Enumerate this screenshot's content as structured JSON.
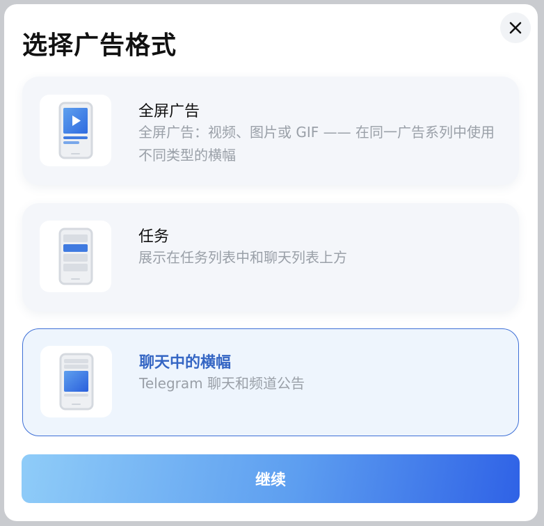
{
  "dialog": {
    "title": "选择广告格式",
    "close_icon": "close-icon"
  },
  "options": [
    {
      "title": "全屏广告",
      "description": "全屏广告：视频、图片或 GIF —— 在同一广告系列中使用不同类型的横幅",
      "icon": "phone-video-icon",
      "selected": false
    },
    {
      "title": "任务",
      "description": "展示在任务列表中和聊天列表上方",
      "icon": "phone-task-list-icon",
      "selected": false
    },
    {
      "title": "聊天中的横幅",
      "description": "Telegram 聊天和频道公告",
      "icon": "phone-banner-icon",
      "selected": true
    }
  ],
  "continue_label": "继续",
  "colors": {
    "accent": "#3566c4",
    "selected_border": "#3d6fd6",
    "option_bg": "#f4f6fa",
    "selected_bg": "#eef5fd",
    "muted_text": "#9aa0a8",
    "button_gradient_start": "#8fccf8",
    "button_gradient_end": "#2f62e6"
  }
}
